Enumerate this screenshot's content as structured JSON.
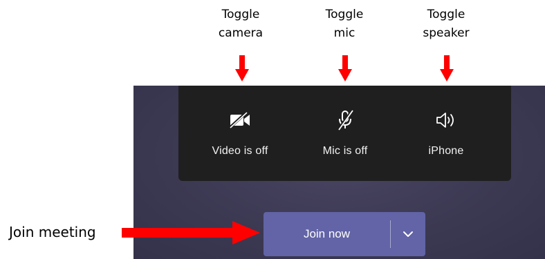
{
  "annotations": {
    "camera": [
      "Toggle",
      "camera"
    ],
    "mic": [
      "Toggle",
      "mic"
    ],
    "speaker": [
      "Toggle",
      "speaker"
    ],
    "join": "Join meeting"
  },
  "controls": {
    "video": {
      "label": "Video is off",
      "icon": "video-off-icon"
    },
    "mic": {
      "label": "Mic is off",
      "icon": "mic-off-icon"
    },
    "speaker": {
      "label": "iPhone",
      "icon": "speaker-icon"
    }
  },
  "join_button": {
    "label": "Join now",
    "dropdown_icon": "chevron-down-icon"
  },
  "colors": {
    "arrow": "#ff0000",
    "controls_bg": "#1f1f1f",
    "join_bg": "#6264a7",
    "background": "#3c3953"
  }
}
